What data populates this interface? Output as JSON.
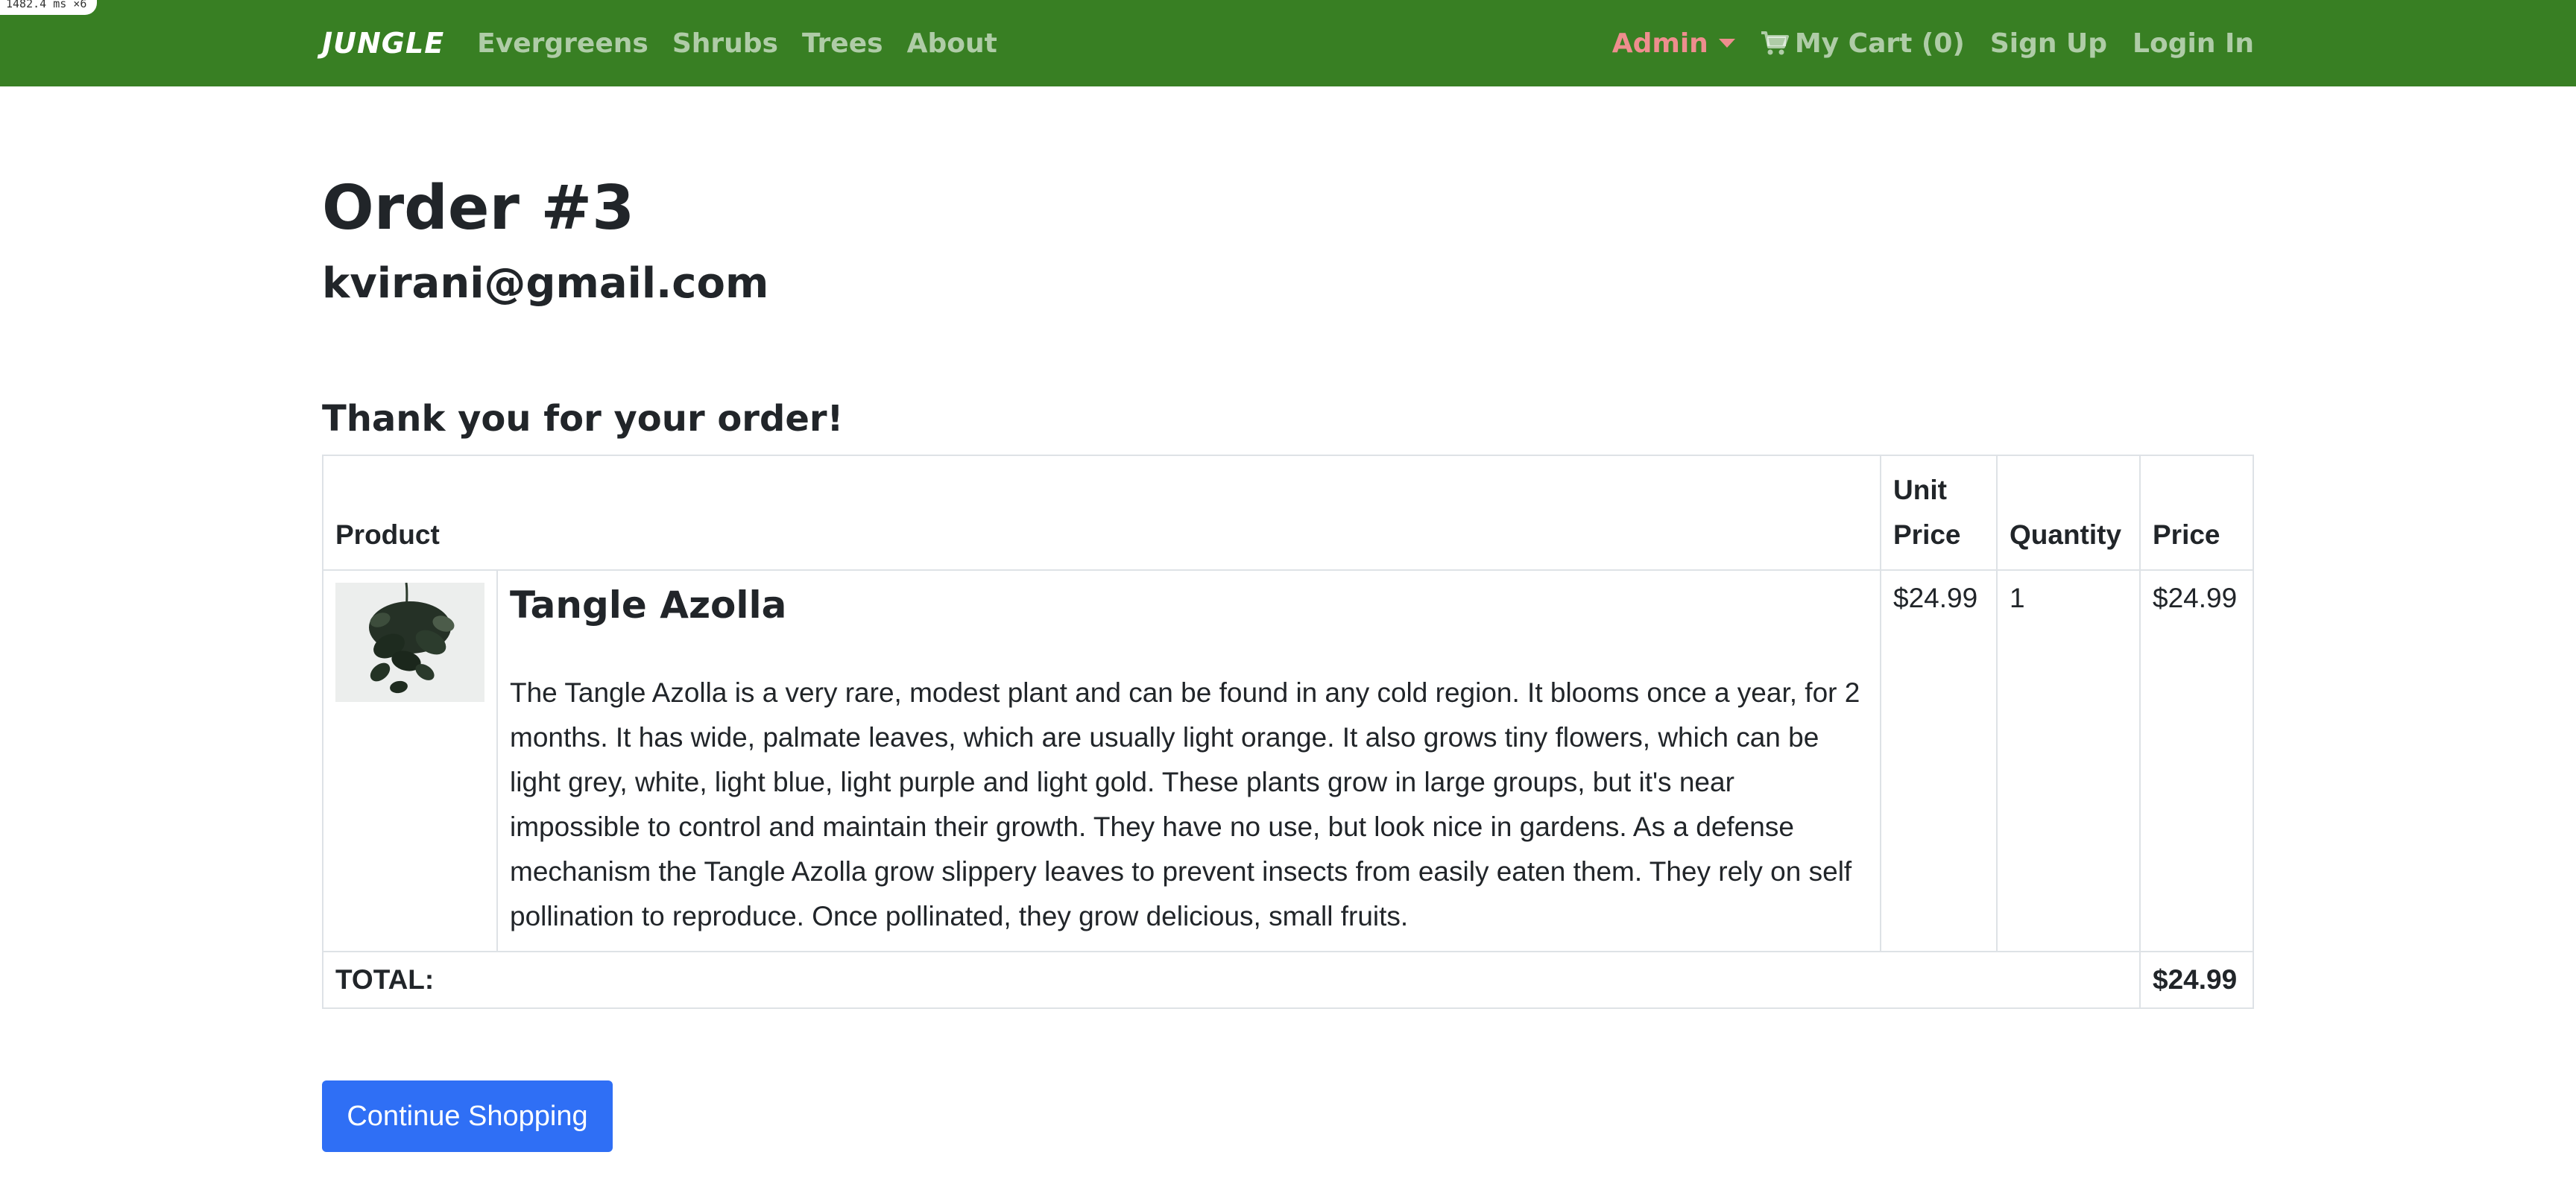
{
  "perf_badge": "1482.4 ms ×6",
  "navbar": {
    "brand": "JUNGLE",
    "links": [
      "Evergreens",
      "Shrubs",
      "Trees",
      "About"
    ],
    "admin": "Admin",
    "cart": "My Cart (0)",
    "signup": "Sign Up",
    "login": "Login In",
    "background_color": "#387f23",
    "admin_color": "#ee8e8e"
  },
  "order": {
    "title": "Order #3",
    "email": "kvirani@gmail.com",
    "thanks": "Thank you for your order!"
  },
  "table": {
    "headers": {
      "product": "Product",
      "unit_price": "Unit Price",
      "quantity": "Quantity",
      "price": "Price"
    },
    "items": [
      {
        "name": "Tangle Azolla",
        "image_icon": "potted-plant-image",
        "description": "The Tangle Azolla is a very rare, modest plant and can be found in any cold region. It blooms once a year, for 2 months. It has wide, palmate leaves, which are usually light orange. It also grows tiny flowers, which can be light grey, white, light blue, light purple and light gold. These plants grow in large groups, but it's near impossible to control and maintain their growth. They have no use, but look nice in gardens. As a defense mechanism the Tangle Azolla grow slippery leaves to prevent insects from easily eaten them. They rely on self pollination to reproduce. Once pollinated, they grow delicious, small fruits.",
        "unit_price": "$24.99",
        "quantity": "1",
        "price": "$24.99"
      }
    ],
    "total_label": "TOTAL:",
    "total_value": "$24.99"
  },
  "continue_button": "Continue Shopping",
  "button_color": "#2f6ff5"
}
